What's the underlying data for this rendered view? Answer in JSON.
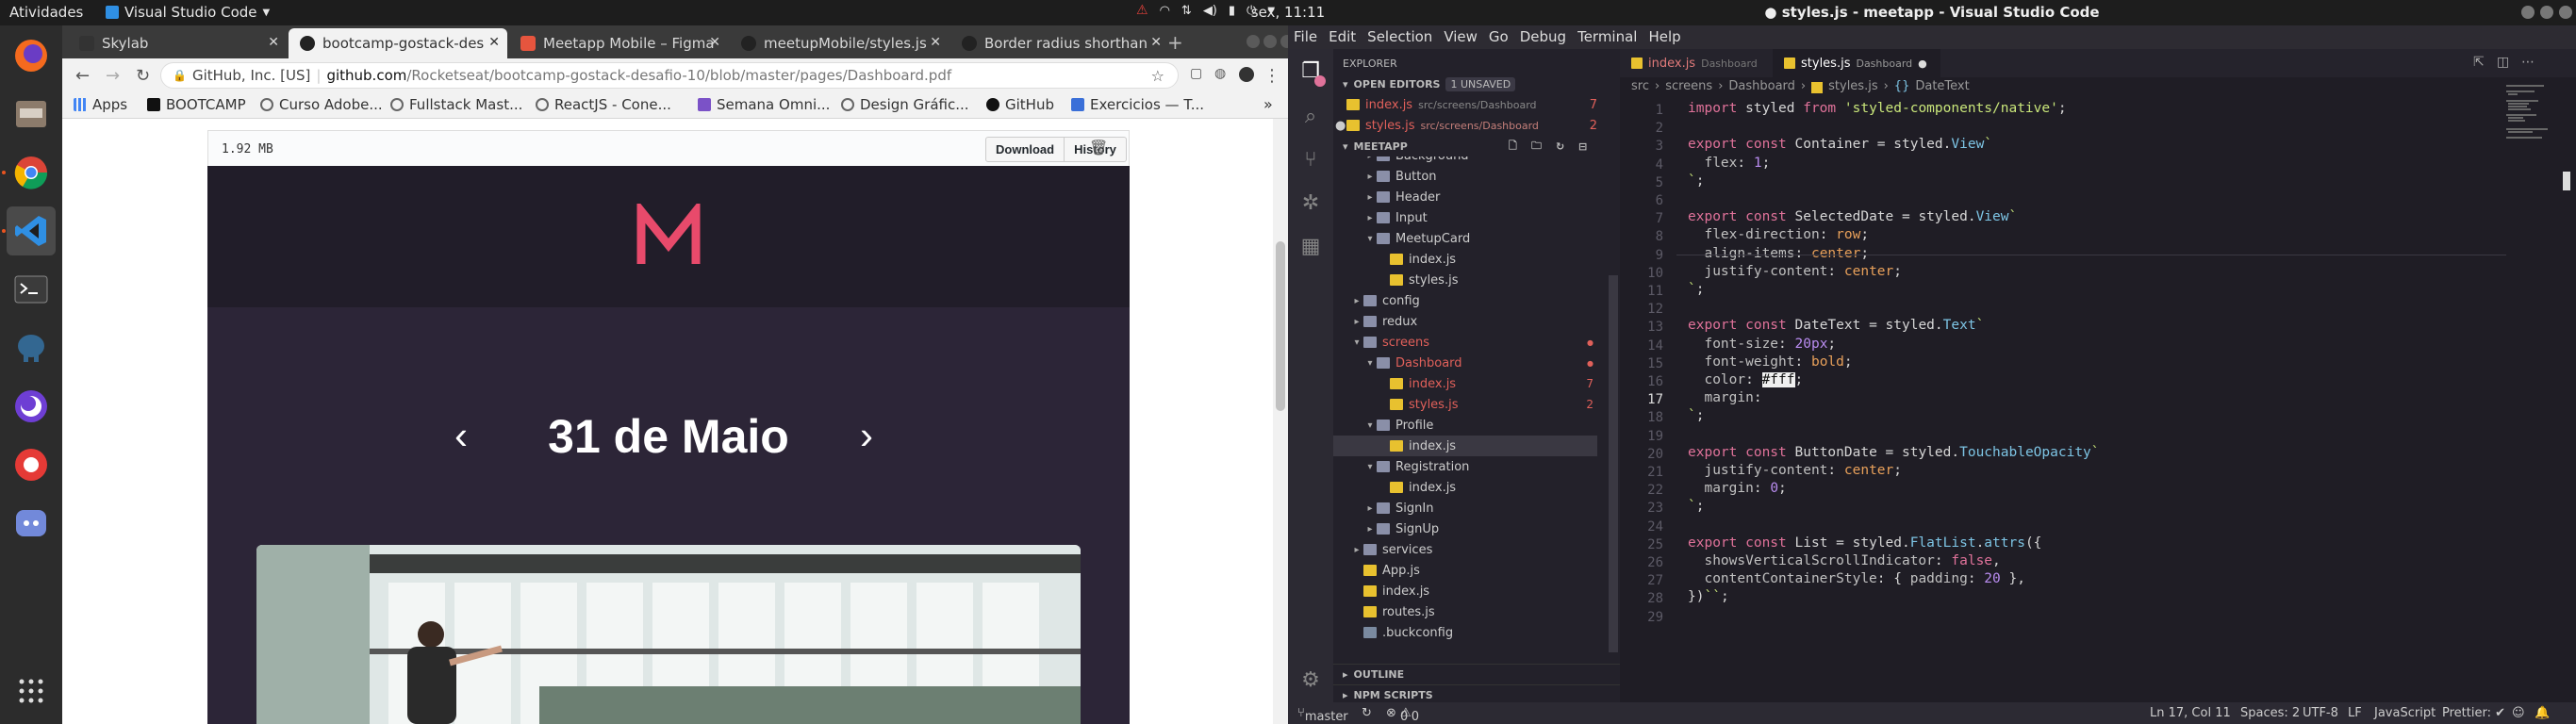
{
  "topbar": {
    "activities": "Atividades",
    "app_name": "Visual Studio Code",
    "clock": "sex, 11:11"
  },
  "dock": {
    "items": [
      "firefox",
      "files",
      "chrome",
      "vscode",
      "terminal",
      "postgres",
      "insomnia",
      "bug-tracker",
      "discord",
      "app-grid"
    ]
  },
  "chrome": {
    "tabs": [
      {
        "label": "Skylab",
        "active": false,
        "favicon_color": "#333333"
      },
      {
        "label": "bootcamp-gostack-desa",
        "active": true,
        "favicon_color": "#222222"
      },
      {
        "label": "Meetapp Mobile – Figma",
        "active": false,
        "favicon_color": "#e6553e"
      },
      {
        "label": "meetupMobile/styles.js",
        "active": false,
        "favicon_color": "#222222"
      },
      {
        "label": "Border radius shorthan",
        "active": false,
        "favicon_color": "#222222"
      }
    ],
    "omnibox": {
      "site": "GitHub, Inc. [US]",
      "host": "github.com",
      "path": "/Rocketseat/bootcamp-gostack-desafio-10/blob/master/pages/Dashboard.pdf"
    },
    "bookmarks": [
      {
        "label": "Apps",
        "color": "#4285f4"
      },
      {
        "label": "BOOTCAMP",
        "color": "#111111"
      },
      {
        "label": "Curso Adobe...",
        "color": "#555555"
      },
      {
        "label": "Fullstack Mast...",
        "color": "#555555"
      },
      {
        "label": "ReactJS - Cone...",
        "color": "#555555"
      },
      {
        "label": "Semana Omni...",
        "color": "#7b52c7"
      },
      {
        "label": "Design Gráfic...",
        "color": "#555555"
      },
      {
        "label": "GitHub",
        "color": "#111111"
      },
      {
        "label": "Exercicios — T...",
        "color": "#3a6fd8"
      }
    ],
    "file": {
      "size": "1.92 MB",
      "download_label": "Download",
      "history_label": "History"
    },
    "pdf": {
      "logo": "M",
      "date": "31 de Maio",
      "prev": "‹",
      "next": "›",
      "accent": "#e84a6b"
    }
  },
  "vscode": {
    "title": "● styles.js - meetapp - Visual Studio Code",
    "menu": [
      "File",
      "Edit",
      "Selection",
      "View",
      "Go",
      "Debug",
      "Terminal",
      "Help"
    ],
    "explorer_title": "EXPLORER",
    "open_editors_label": "OPEN EDITORS",
    "unsaved_badge": "1 UNSAVED",
    "open_editors": [
      {
        "name": "index.js",
        "path": "src/screens/Dashboard",
        "count": "7"
      },
      {
        "name": "styles.js",
        "path": "src/screens/Dashboard",
        "count": "2"
      }
    ],
    "project_label": "MEETAPP",
    "tree": [
      {
        "label": "Background",
        "type": "folder",
        "depth": 1,
        "open": false
      },
      {
        "label": "Button",
        "type": "folder",
        "depth": 1,
        "open": false
      },
      {
        "label": "Header",
        "type": "folder",
        "depth": 1,
        "open": false
      },
      {
        "label": "Input",
        "type": "folder",
        "depth": 1,
        "open": false
      },
      {
        "label": "MeetupCard",
        "type": "folder",
        "depth": 1,
        "open": true
      },
      {
        "label": "index.js",
        "type": "js",
        "depth": 2
      },
      {
        "label": "styles.js",
        "type": "js",
        "depth": 2
      },
      {
        "label": "config",
        "type": "folder",
        "depth": 0,
        "open": false
      },
      {
        "label": "redux",
        "type": "folder",
        "depth": 0,
        "open": false
      },
      {
        "label": "screens",
        "type": "folder",
        "depth": 0,
        "open": true,
        "modified": true
      },
      {
        "label": "Dashboard",
        "type": "folder",
        "depth": 1,
        "open": true,
        "modified": true
      },
      {
        "label": "index.js",
        "type": "js",
        "depth": 2,
        "modified": true,
        "badge": "7"
      },
      {
        "label": "styles.js",
        "type": "js",
        "depth": 2,
        "modified": true,
        "badge": "2"
      },
      {
        "label": "Profile",
        "type": "folder",
        "depth": 1,
        "open": true
      },
      {
        "label": "index.js",
        "type": "js",
        "depth": 2,
        "selected": true
      },
      {
        "label": "Registration",
        "type": "folder",
        "depth": 1,
        "open": true
      },
      {
        "label": "index.js",
        "type": "js",
        "depth": 2
      },
      {
        "label": "SignIn",
        "type": "folder",
        "depth": 1,
        "open": false
      },
      {
        "label": "SignUp",
        "type": "folder",
        "depth": 1,
        "open": false
      },
      {
        "label": "services",
        "type": "folder",
        "depth": 0,
        "open": false
      },
      {
        "label": "App.js",
        "type": "js",
        "depth": 0
      },
      {
        "label": "index.js",
        "type": "js",
        "depth": 0
      },
      {
        "label": "routes.js",
        "type": "js",
        "depth": 0
      },
      {
        "label": ".buckconfig",
        "type": "file",
        "depth": -1
      }
    ],
    "outline_label": "OUTLINE",
    "npm_label": "NPM SCRIPTS",
    "tabs": [
      {
        "name": "index.js",
        "path": "Dashboard",
        "active": false
      },
      {
        "name": "styles.js",
        "path": "Dashboard",
        "active": true
      }
    ],
    "breadcrumb": [
      "src",
      "screens",
      "Dashboard",
      "styles.js",
      "DateText"
    ],
    "code": [
      [
        [
          "kw",
          "import "
        ],
        [
          "id",
          "styled "
        ],
        [
          "kw",
          "from "
        ],
        [
          "str",
          "'styled-components/native'"
        ],
        [
          "id",
          ";"
        ]
      ],
      [],
      [
        [
          "kw",
          "export const "
        ],
        [
          "id",
          "Container = styled."
        ],
        [
          "fn",
          "View"
        ],
        [
          "str",
          "`"
        ]
      ],
      [
        [
          "prop",
          "  flex"
        ],
        [
          "id",
          ": "
        ],
        [
          "num",
          "1"
        ],
        [
          "id",
          ";"
        ]
      ],
      [
        [
          "str",
          "`"
        ],
        [
          "id",
          ";"
        ]
      ],
      [],
      [
        [
          "kw",
          "export const "
        ],
        [
          "id",
          "SelectedDate = styled."
        ],
        [
          "fn",
          "View"
        ],
        [
          "str",
          "`"
        ]
      ],
      [
        [
          "prop",
          "  flex-direction"
        ],
        [
          "id",
          ": "
        ],
        [
          "vl",
          "row"
        ],
        [
          "id",
          ";"
        ]
      ],
      [
        [
          "prop",
          "  align-items"
        ],
        [
          "id",
          ": "
        ],
        [
          "vl",
          "center"
        ],
        [
          "id",
          ";"
        ]
      ],
      [
        [
          "prop",
          "  justify-content"
        ],
        [
          "id",
          ": "
        ],
        [
          "vl",
          "center"
        ],
        [
          "id",
          ";"
        ]
      ],
      [
        [
          "str",
          "`"
        ],
        [
          "id",
          ";"
        ]
      ],
      [],
      [
        [
          "kw",
          "export const "
        ],
        [
          "id",
          "DateText = styled."
        ],
        [
          "fn",
          "Text"
        ],
        [
          "str",
          "`"
        ]
      ],
      [
        [
          "prop",
          "  font-size"
        ],
        [
          "id",
          ": "
        ],
        [
          "num",
          "20px"
        ],
        [
          "id",
          ";"
        ]
      ],
      [
        [
          "prop",
          "  font-weight"
        ],
        [
          "id",
          ": "
        ],
        [
          "vl",
          "bold"
        ],
        [
          "id",
          ";"
        ]
      ],
      [
        [
          "prop",
          "  color"
        ],
        [
          "id",
          ": "
        ],
        [
          "id",
          "#fff"
        ],
        [
          "id",
          ";"
        ]
      ],
      [
        [
          "prop",
          "  margin"
        ],
        [
          "id",
          ":"
        ]
      ],
      [
        [
          "str",
          "`"
        ],
        [
          "id",
          ";"
        ]
      ],
      [],
      [
        [
          "kw",
          "export const "
        ],
        [
          "id",
          "ButtonDate = styled."
        ],
        [
          "fn",
          "TouchableOpacity"
        ],
        [
          "str",
          "`"
        ]
      ],
      [
        [
          "prop",
          "  justify-content"
        ],
        [
          "id",
          ": "
        ],
        [
          "vl",
          "center"
        ],
        [
          "id",
          ";"
        ]
      ],
      [
        [
          "prop",
          "  margin"
        ],
        [
          "id",
          ": "
        ],
        [
          "num",
          "0"
        ],
        [
          "id",
          ";"
        ]
      ],
      [
        [
          "str",
          "`"
        ],
        [
          "id",
          ";"
        ]
      ],
      [],
      [
        [
          "kw",
          "export const "
        ],
        [
          "id",
          "List = styled."
        ],
        [
          "fn",
          "FlatList"
        ],
        [
          "id",
          "."
        ],
        [
          "fn",
          "attrs"
        ],
        [
          "id",
          "({"
        ]
      ],
      [
        [
          "prop",
          "  showsVerticalScrollIndicator"
        ],
        [
          "id",
          ": "
        ],
        [
          "kw",
          "false"
        ],
        [
          "id",
          ","
        ]
      ],
      [
        [
          "prop",
          "  contentContainerStyle"
        ],
        [
          "id",
          ": { "
        ],
        [
          "prop",
          "padding"
        ],
        [
          "id",
          ": "
        ],
        [
          "num",
          "20"
        ],
        [
          "id",
          " },"
        ]
      ],
      [
        [
          "id",
          "})"
        ],
        [
          "str",
          "``"
        ],
        [
          "id",
          ";"
        ]
      ],
      []
    ],
    "status": {
      "branch": "master",
      "errors": "0",
      "warnings": "0",
      "cursor": "Ln 17, Col 11",
      "spaces": "Spaces: 2",
      "encoding": "UTF-8",
      "eol": "LF",
      "language": "JavaScript",
      "prettier": "Prettier: ✔"
    }
  }
}
